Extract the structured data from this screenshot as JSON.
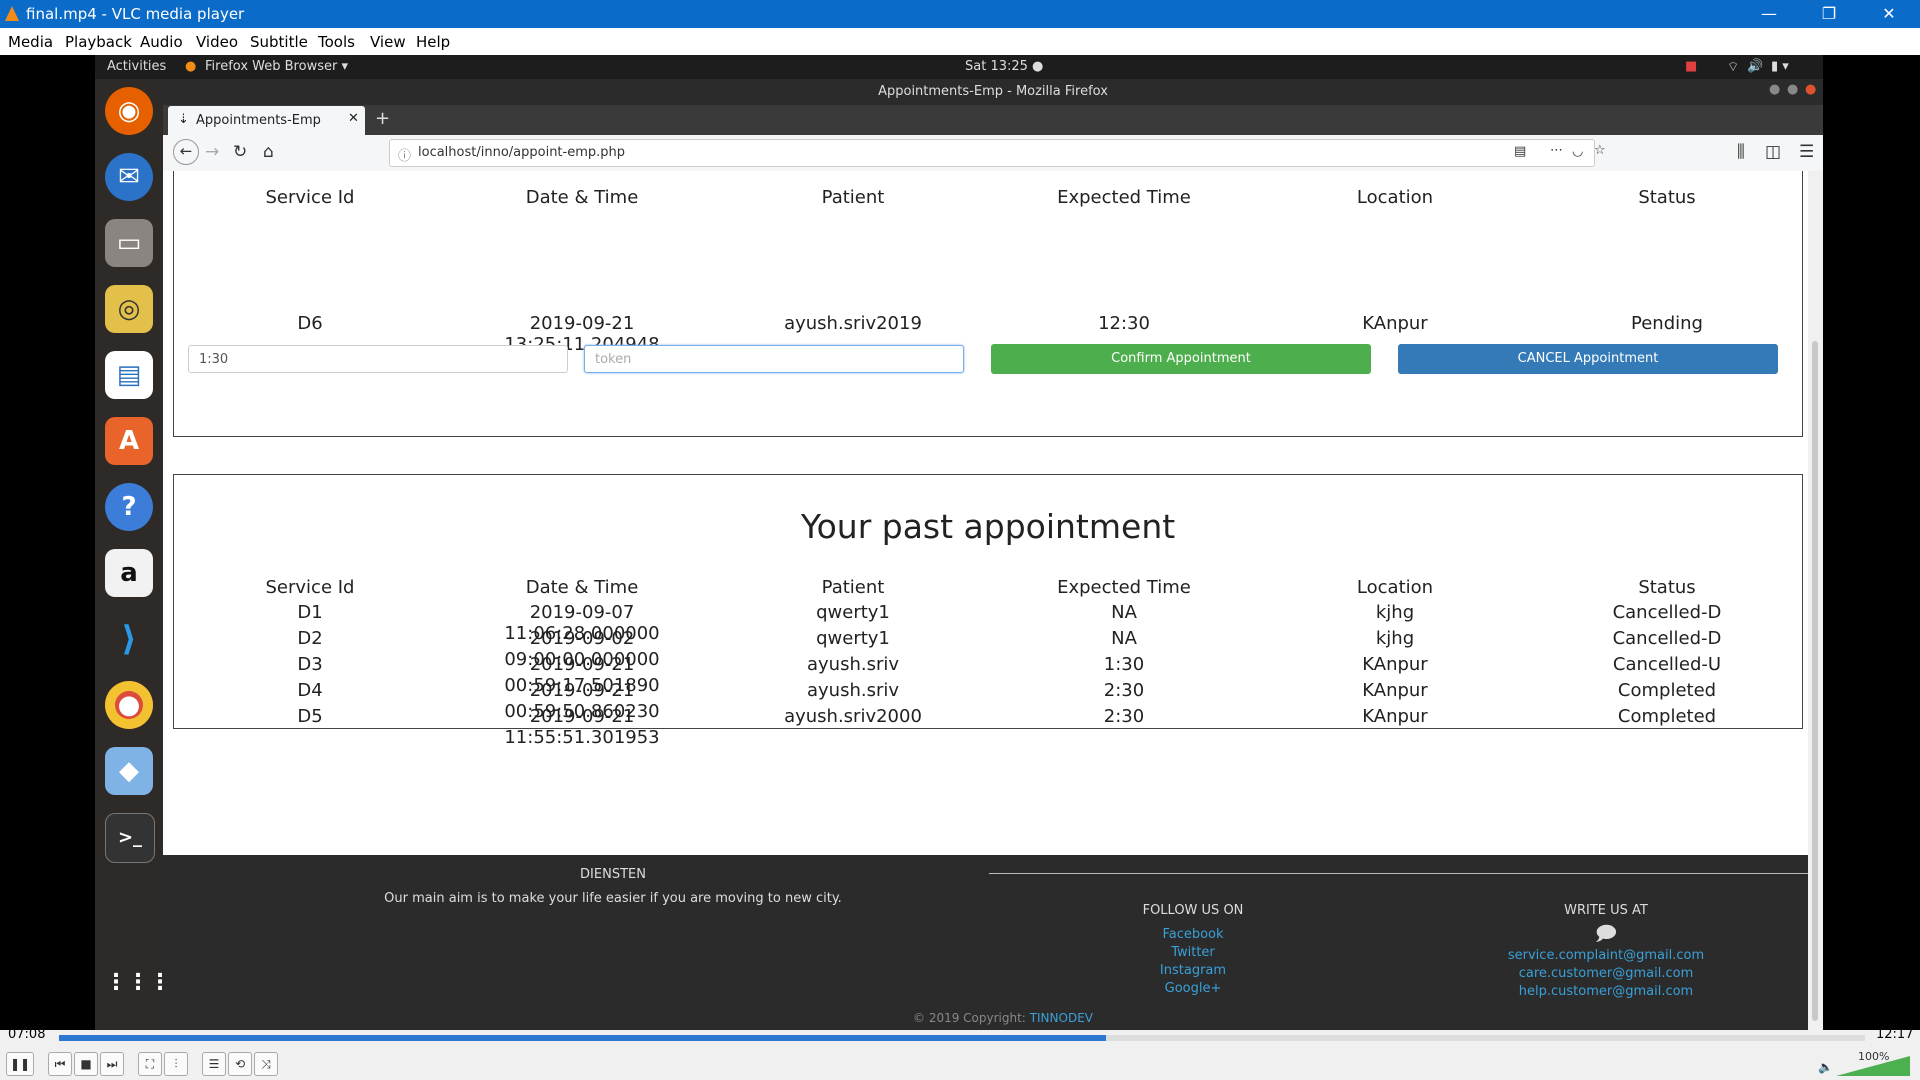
{
  "vlc": {
    "window_title": "final.mp4 - VLC media player",
    "menu": [
      "Media",
      "Playback",
      "Audio",
      "Video",
      "Subtitle",
      "Tools",
      "View",
      "Help"
    ],
    "time_elapsed": "07:08",
    "time_total": "12:17",
    "progress": 0.58,
    "volume": "100%"
  },
  "ubuntu": {
    "activities": "Activities",
    "app_menu": "Firefox Web Browser ▾",
    "clock": "Sat 13:25 ●"
  },
  "firefox": {
    "window_title": "Appointments-Emp - Mozilla Firefox",
    "tab_label": "Appointments-Emp",
    "url": "localhost/inno/appoint-emp.php"
  },
  "upcoming": {
    "headers": [
      "Service Id",
      "Date & Time",
      "Patient",
      "Expected Time",
      "Location",
      "Status"
    ],
    "row": [
      "D6",
      "2019-09-21 13:25:11.204948",
      "ayush.sriv2019",
      "12:30",
      "KAnpur",
      "Pending"
    ],
    "time_input_value": "1:30",
    "token_placeholder": "token",
    "confirm_label": "Confirm Appointment",
    "cancel_label": "CANCEL Appointment"
  },
  "past": {
    "title": "Your past appointment",
    "headers": [
      "Service Id",
      "Date & Time",
      "Patient",
      "Expected Time",
      "Location",
      "Status"
    ],
    "rows": [
      [
        "D1",
        "2019-09-07 11:06:28.000000",
        "qwerty1",
        "NA",
        "kjhg",
        "Cancelled-D"
      ],
      [
        "D2",
        "2019-09-02 09:00:00.000000",
        "qwerty1",
        "NA",
        "kjhg",
        "Cancelled-D"
      ],
      [
        "D3",
        "2019-09-21 00:59:17.501890",
        "ayush.sriv",
        "1:30",
        "KAnpur",
        "Cancelled-U"
      ],
      [
        "D4",
        "2019-09-21 00:59:50.860230",
        "ayush.sriv",
        "2:30",
        "KAnpur",
        "Completed"
      ],
      [
        "D5",
        "2019-09-21 11:55:51.301953",
        "ayush.sriv2000",
        "2:30",
        "KAnpur",
        "Completed"
      ]
    ]
  },
  "footer": {
    "brand": "DIENSTEN",
    "tagline": "Our main aim is to make your life easier if you are moving to new city.",
    "follow_title": "FOLLOW US ON",
    "follow_links": [
      "Facebook",
      "Twitter",
      "Instagram",
      "Google+"
    ],
    "write_title": "WRITE US AT",
    "emails": [
      "service.complaint@gmail.com",
      "care.customer@gmail.com",
      "help.customer@gmail.com"
    ],
    "copyright": "© 2019 Copyright:",
    "copyright_link": "TINNODEV"
  },
  "colors": {
    "vlc_blue": "#0b6bc9",
    "confirm_green": "#4cae4c",
    "cancel_blue": "#337ab7",
    "footer_bg": "#2b2b2b",
    "link_blue": "#3aa0d8"
  }
}
